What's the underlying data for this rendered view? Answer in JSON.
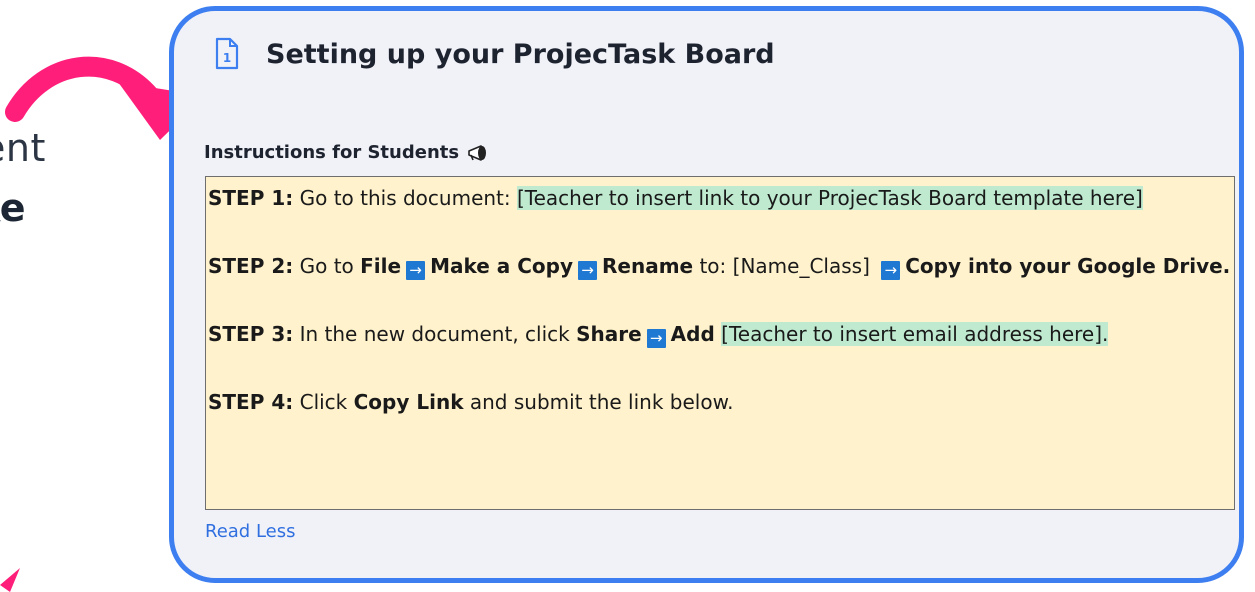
{
  "side": {
    "line1": "ent",
    "line2": "ke",
    "arrow_color": "#ff1f7a"
  },
  "card": {
    "border_color": "#3d7ff0",
    "icon": "document-1-icon",
    "title": "Setting up your ProjecTask Board",
    "instructions_heading": "Instructions for Students",
    "heading_icon": "megaphone-icon",
    "steps": {
      "s1_label": "STEP 1:",
      "s1_text": " Go to this document: ",
      "s1_highlight": "[Teacher to insert link to your ProjecTask Board template here]",
      "s2_label": "STEP 2:",
      "s2_go": " Go to ",
      "s2_file": "File",
      "s2_make": "Make a Copy",
      "s2_rename": "Rename",
      "s2_to": " to: [Name_Class] ",
      "s2_copy": "Copy into your Google Drive.",
      "s3_label": "STEP 3:",
      "s3_text": " In the new document, click ",
      "s3_share": "Share",
      "s3_add": "Add",
      "s3_highlight": "[Teacher to insert email address here].",
      "s4_label": "STEP 4:",
      "s4_click": " Click ",
      "s4_copy": "Copy Link",
      "s4_rest": " and submit the link below.",
      "arrow_glyph": "→"
    },
    "read_less": "Read Less"
  }
}
